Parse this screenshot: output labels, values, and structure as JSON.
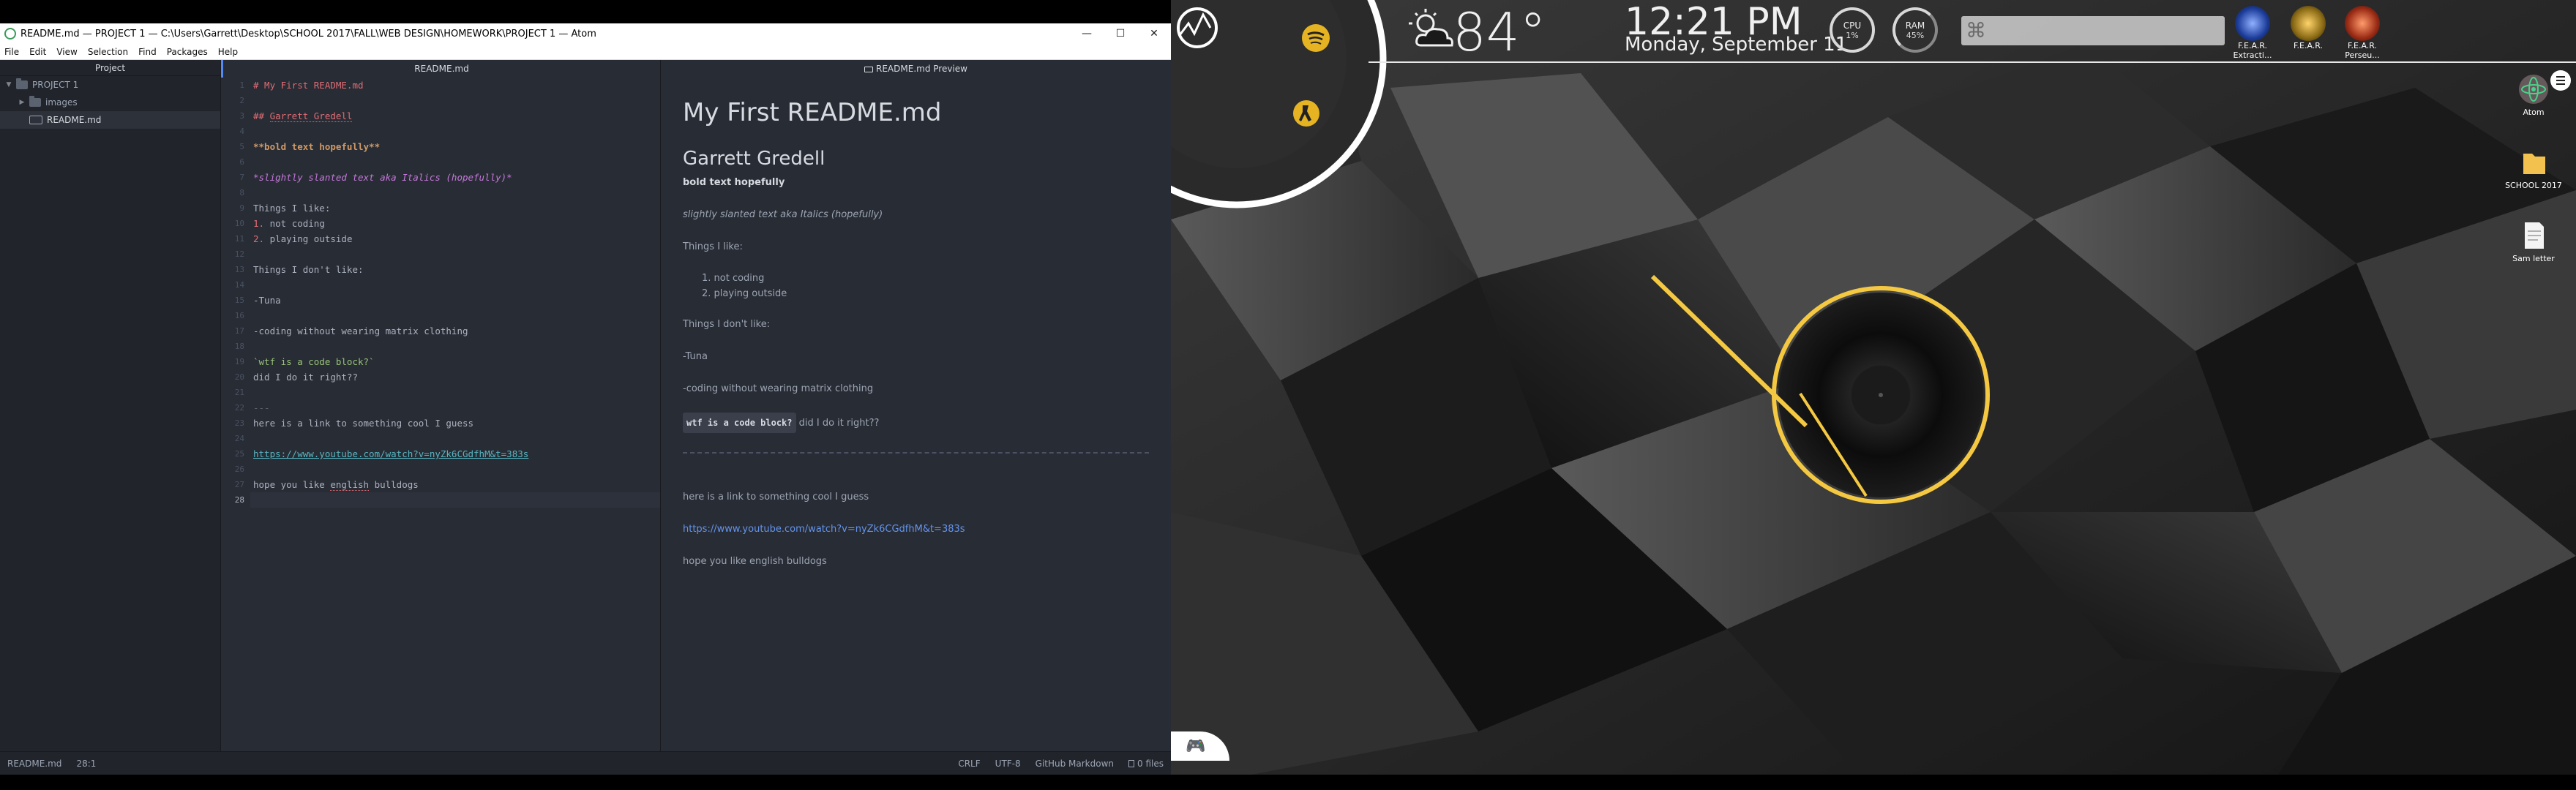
{
  "window": {
    "title": "README.md — PROJECT 1 — C:\\Users\\Garrett\\Desktop\\SCHOOL 2017\\FALL\\WEB DESIGN\\HOMEWORK\\PROJECT 1 — Atom",
    "controls": {
      "minimize": "—",
      "maximize": "☐",
      "close": "✕"
    }
  },
  "menu": [
    "File",
    "Edit",
    "View",
    "Selection",
    "Find",
    "Packages",
    "Help"
  ],
  "tree": {
    "header": "Project",
    "root": "PROJECT 1",
    "folder": "images",
    "file": "README.md"
  },
  "editor": {
    "tab": "README.md",
    "line_numbers": [
      "1",
      "2",
      "3",
      "4",
      "5",
      "6",
      "7",
      "8",
      "9",
      "10",
      "11",
      "12",
      "13",
      "14",
      "15",
      "16",
      "17",
      "18",
      "19",
      "20",
      "21",
      "22",
      "23",
      "24",
      "25",
      "26",
      "27",
      "28"
    ],
    "lines": {
      "l1": "# My First README.md",
      "l3_prefix": "## ",
      "l3_name": "Garrett Gredell",
      "l5": "**bold text hopefully**",
      "l7": "*slightly slanted text aka Italics (hopefully)*",
      "l9": "Things I like:",
      "l10_num": "1.",
      "l10_text": " not coding",
      "l11_num": "2.",
      "l11_text": " playing outside",
      "l13": "Things I don't like:",
      "l15": "-Tuna",
      "l17": "-coding without wearing matrix clothing",
      "l19": "`wtf is a code block?`",
      "l20": "did I do it right??",
      "l22": "---",
      "l23": "here is a link to something cool I guess",
      "l25": "https://www.youtube.com/watch?v=nyZk6CGdfhM&t=383s",
      "l27_a": "hope you like ",
      "l27_b": "english",
      "l27_c": " bulldogs"
    }
  },
  "preview": {
    "tab": "README.md Preview",
    "h1": "My First README.md",
    "h2": "Garrett Gredell",
    "bold": "bold text hopefully",
    "italic": "slightly slanted text aka Italics (hopefully)",
    "likes_label": "Things I like:",
    "likes": [
      "1. not coding",
      "2. playing outside"
    ],
    "dislikes_label": "Things I don't like:",
    "tuna": "-Tuna",
    "matrix": "-coding without wearing matrix clothing",
    "code": "wtf is a code block?",
    "code_after": " did I do it right??",
    "link_intro": "here is a link to something cool I guess",
    "link": "https://www.youtube.com/watch?v=nyZk6CGdfhM&t=383s",
    "outro": "hope you like english bulldogs"
  },
  "statusbar": {
    "file": "README.md",
    "position": "28:1",
    "line_ending": "CRLF",
    "encoding": "UTF-8",
    "grammar": "GitHub Markdown",
    "files": "0 files"
  },
  "desktop": {
    "temperature": "84°",
    "time": "12:21 PM",
    "date": "Monday, September 11",
    "cpu_label": "CPU",
    "cpu_value": "1%",
    "ram_label": "RAM",
    "ram_value": "45%",
    "search_glyph": "⌘",
    "games": [
      "F.E.A.R. Extracti...",
      "F.E.A.R.",
      "F.E.A.R. Perseu..."
    ],
    "icons": [
      "Atom",
      "SCHOOL 2017",
      "Sam letter"
    ],
    "colors": {
      "accent_yellow": "#f5c842",
      "spotify": "#e6b422"
    }
  }
}
